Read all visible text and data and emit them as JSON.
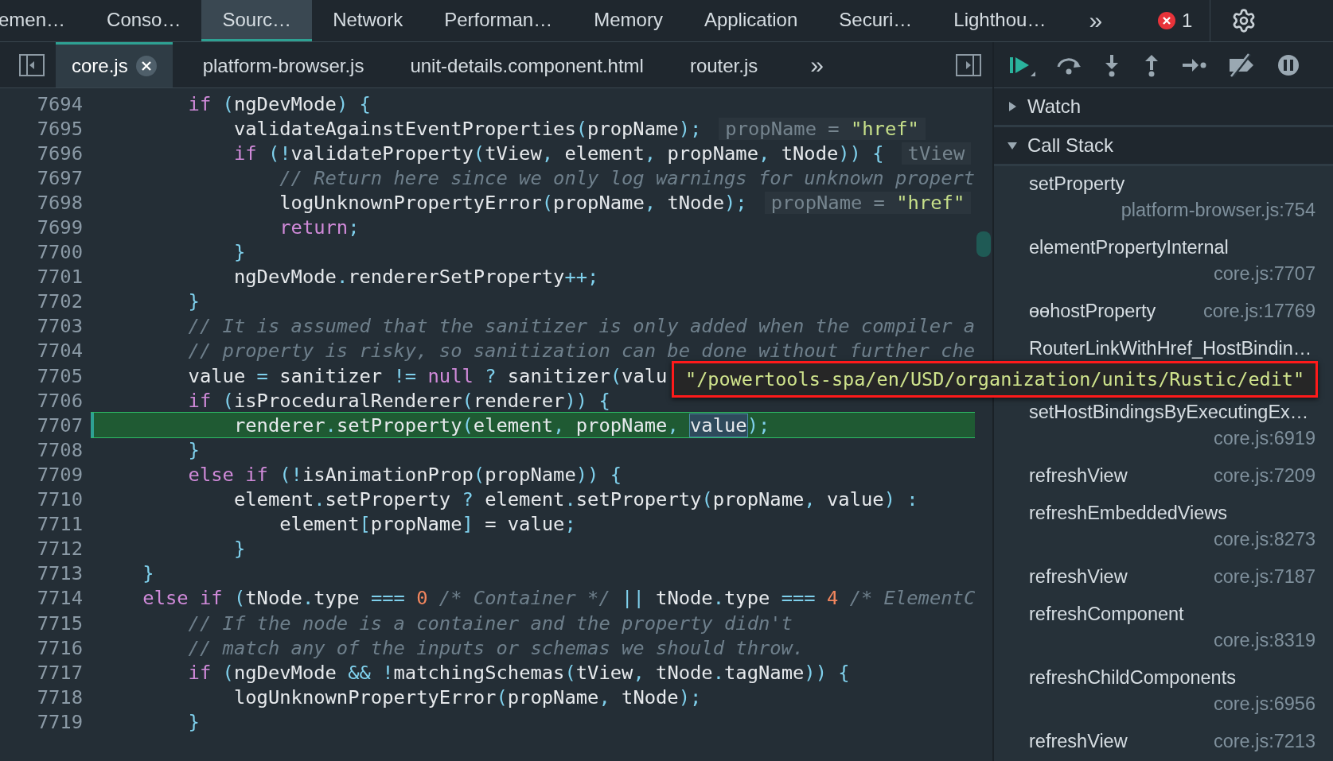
{
  "panel_tabs": [
    {
      "label": "emen…",
      "selected": false
    },
    {
      "label": "Conso…",
      "selected": false
    },
    {
      "label": "Sourc…",
      "selected": true
    },
    {
      "label": "Network",
      "selected": false
    },
    {
      "label": "Performan…",
      "selected": false
    },
    {
      "label": "Memory",
      "selected": false
    },
    {
      "label": "Application",
      "selected": false
    },
    {
      "label": "Securi…",
      "selected": false
    },
    {
      "label": "Lighthou…",
      "selected": false
    }
  ],
  "more_tabs": "»",
  "error_count": "1",
  "file_tabs": [
    {
      "label": "core.js",
      "selected": true,
      "closable": true
    },
    {
      "label": "platform-browser.js",
      "selected": false,
      "closable": false
    },
    {
      "label": "unit-details.component.html",
      "selected": false,
      "closable": false
    },
    {
      "label": "router.js",
      "selected": false,
      "closable": false
    }
  ],
  "more_files": "»",
  "code_lines": [
    {
      "number": "7694",
      "current": false,
      "tokens": [
        {
          "kind": "kw",
          "text": "        if "
        },
        {
          "kind": "p",
          "text": "("
        },
        {
          "kind": "id",
          "text": "ngDevMode"
        },
        {
          "kind": "p",
          "text": ") {"
        }
      ]
    },
    {
      "number": "7695",
      "current": false,
      "tokens": [
        {
          "kind": "id",
          "text": "            validateAgainstEventProperties"
        },
        {
          "kind": "p",
          "text": "("
        },
        {
          "kind": "id",
          "text": "propName"
        },
        {
          "kind": "p",
          "text": ");"
        }
      ],
      "inline_value": {
        "label": "propName =",
        "value": "\"href\""
      }
    },
    {
      "number": "7696",
      "current": false,
      "tokens": [
        {
          "kind": "kw",
          "text": "            if "
        },
        {
          "kind": "p",
          "text": "(!"
        },
        {
          "kind": "id",
          "text": "validateProperty"
        },
        {
          "kind": "p",
          "text": "("
        },
        {
          "kind": "id",
          "text": "tView"
        },
        {
          "kind": "p",
          "text": ", "
        },
        {
          "kind": "id",
          "text": "element"
        },
        {
          "kind": "p",
          "text": ", "
        },
        {
          "kind": "id",
          "text": "propName"
        },
        {
          "kind": "p",
          "text": ", "
        },
        {
          "kind": "id",
          "text": "tNode"
        },
        {
          "kind": "p",
          "text": ")) {"
        }
      ],
      "inline_value": {
        "label": "tView"
      }
    },
    {
      "number": "7697",
      "current": false,
      "tokens": [
        {
          "kind": "cm",
          "text": "                // Return here since we only log warnings for unknown propert"
        }
      ]
    },
    {
      "number": "7698",
      "current": false,
      "tokens": [
        {
          "kind": "id",
          "text": "                logUnknownPropertyError"
        },
        {
          "kind": "p",
          "text": "("
        },
        {
          "kind": "id",
          "text": "propName"
        },
        {
          "kind": "p",
          "text": ", "
        },
        {
          "kind": "id",
          "text": "tNode"
        },
        {
          "kind": "p",
          "text": ");"
        }
      ],
      "inline_value": {
        "label": "propName =",
        "value": "\"href\""
      }
    },
    {
      "number": "7699",
      "current": false,
      "tokens": [
        {
          "kind": "kw",
          "text": "                return"
        },
        {
          "kind": "p",
          "text": ";"
        }
      ]
    },
    {
      "number": "7700",
      "current": false,
      "tokens": [
        {
          "kind": "p",
          "text": "            }"
        }
      ]
    },
    {
      "number": "7701",
      "current": false,
      "tokens": [
        {
          "kind": "id",
          "text": "            ngDevMode"
        },
        {
          "kind": "p",
          "text": "."
        },
        {
          "kind": "id",
          "text": "rendererSetProperty"
        },
        {
          "kind": "p",
          "text": "++;"
        }
      ]
    },
    {
      "number": "7702",
      "current": false,
      "tokens": [
        {
          "kind": "p",
          "text": "        }"
        }
      ]
    },
    {
      "number": "7703",
      "current": false,
      "tokens": [
        {
          "kind": "cm",
          "text": "        // It is assumed that the sanitizer is only added when the compiler a"
        }
      ]
    },
    {
      "number": "7704",
      "current": false,
      "tokens": [
        {
          "kind": "cm",
          "text": "        // property is risky, so sanitization can be done without further che"
        }
      ]
    },
    {
      "number": "7705",
      "current": false,
      "tokens": [
        {
          "kind": "id",
          "text": "        value "
        },
        {
          "kind": "p",
          "text": "= "
        },
        {
          "kind": "id",
          "text": "sanitizer "
        },
        {
          "kind": "p",
          "text": "!= "
        },
        {
          "kind": "kw",
          "text": "null "
        },
        {
          "kind": "p",
          "text": "? "
        },
        {
          "kind": "id",
          "text": "sanitizer"
        },
        {
          "kind": "p",
          "text": "("
        },
        {
          "kind": "id",
          "text": "valu"
        }
      ]
    },
    {
      "number": "7706",
      "current": false,
      "tokens": [
        {
          "kind": "kw",
          "text": "        if "
        },
        {
          "kind": "p",
          "text": "("
        },
        {
          "kind": "id",
          "text": "isProceduralRenderer"
        },
        {
          "kind": "p",
          "text": "("
        },
        {
          "kind": "id",
          "text": "renderer"
        },
        {
          "kind": "p",
          "text": ")) {"
        }
      ]
    },
    {
      "number": "7707",
      "current": true,
      "tokens": [
        {
          "kind": "id",
          "text": "            renderer"
        },
        {
          "kind": "p",
          "text": "."
        },
        {
          "kind": "id",
          "text": "setProperty"
        },
        {
          "kind": "p",
          "text": "("
        },
        {
          "kind": "id",
          "text": "element"
        },
        {
          "kind": "p",
          "text": ", "
        },
        {
          "kind": "id",
          "text": "propName"
        },
        {
          "kind": "p",
          "text": ", "
        },
        {
          "kind": "hov",
          "text": "value"
        },
        {
          "kind": "p",
          "text": ");"
        }
      ]
    },
    {
      "number": "7708",
      "current": false,
      "tokens": [
        {
          "kind": "p",
          "text": "        }"
        }
      ]
    },
    {
      "number": "7709",
      "current": false,
      "tokens": [
        {
          "kind": "kw",
          "text": "        else if "
        },
        {
          "kind": "p",
          "text": "(!"
        },
        {
          "kind": "id",
          "text": "isAnimationProp"
        },
        {
          "kind": "p",
          "text": "("
        },
        {
          "kind": "id",
          "text": "propName"
        },
        {
          "kind": "p",
          "text": ")) {"
        }
      ]
    },
    {
      "number": "7710",
      "current": false,
      "tokens": [
        {
          "kind": "id",
          "text": "            element"
        },
        {
          "kind": "p",
          "text": "."
        },
        {
          "kind": "id",
          "text": "setProperty "
        },
        {
          "kind": "p",
          "text": "? "
        },
        {
          "kind": "id",
          "text": "element"
        },
        {
          "kind": "p",
          "text": "."
        },
        {
          "kind": "id",
          "text": "setProperty"
        },
        {
          "kind": "p",
          "text": "("
        },
        {
          "kind": "id",
          "text": "propName"
        },
        {
          "kind": "p",
          "text": ", "
        },
        {
          "kind": "id",
          "text": "value"
        },
        {
          "kind": "p",
          "text": ") :"
        }
      ]
    },
    {
      "number": "7711",
      "current": false,
      "tokens": [
        {
          "kind": "id",
          "text": "                element"
        },
        {
          "kind": "p",
          "text": "["
        },
        {
          "kind": "id",
          "text": "propName"
        },
        {
          "kind": "p",
          "text": "] "
        },
        {
          "kind": "id",
          "text": "= value"
        },
        {
          "kind": "p",
          "text": ";"
        }
      ]
    },
    {
      "number": "7712",
      "current": false,
      "tokens": [
        {
          "kind": "p",
          "text": "            }"
        }
      ]
    },
    {
      "number": "7713",
      "current": false,
      "tokens": [
        {
          "kind": "p",
          "text": "    }"
        }
      ]
    },
    {
      "number": "7714",
      "current": false,
      "tokens": [
        {
          "kind": "kw",
          "text": "    else if "
        },
        {
          "kind": "p",
          "text": "("
        },
        {
          "kind": "id",
          "text": "tNode"
        },
        {
          "kind": "p",
          "text": "."
        },
        {
          "kind": "id",
          "text": "type "
        },
        {
          "kind": "p",
          "text": "=== "
        },
        {
          "kind": "num",
          "text": "0 "
        },
        {
          "kind": "cm",
          "text": "/* Container */ "
        },
        {
          "kind": "p",
          "text": "|| "
        },
        {
          "kind": "id",
          "text": "tNode"
        },
        {
          "kind": "p",
          "text": "."
        },
        {
          "kind": "id",
          "text": "type "
        },
        {
          "kind": "p",
          "text": "=== "
        },
        {
          "kind": "num",
          "text": "4 "
        },
        {
          "kind": "cm",
          "text": "/* ElementC"
        }
      ]
    },
    {
      "number": "7715",
      "current": false,
      "tokens": [
        {
          "kind": "cm",
          "text": "        // If the node is a container and the property didn't"
        }
      ]
    },
    {
      "number": "7716",
      "current": false,
      "tokens": [
        {
          "kind": "cm",
          "text": "        // match any of the inputs or schemas we should throw."
        }
      ]
    },
    {
      "number": "7717",
      "current": false,
      "tokens": [
        {
          "kind": "kw",
          "text": "        if "
        },
        {
          "kind": "p",
          "text": "("
        },
        {
          "kind": "id",
          "text": "ngDevMode "
        },
        {
          "kind": "p",
          "text": "&& !"
        },
        {
          "kind": "id",
          "text": "matchingSchemas"
        },
        {
          "kind": "p",
          "text": "("
        },
        {
          "kind": "id",
          "text": "tView"
        },
        {
          "kind": "p",
          "text": ", "
        },
        {
          "kind": "id",
          "text": "tNode"
        },
        {
          "kind": "p",
          "text": "."
        },
        {
          "kind": "id",
          "text": "tagName"
        },
        {
          "kind": "p",
          "text": ")) {"
        }
      ]
    },
    {
      "number": "7718",
      "current": false,
      "tokens": [
        {
          "kind": "id",
          "text": "            logUnknownPropertyError"
        },
        {
          "kind": "p",
          "text": "("
        },
        {
          "kind": "id",
          "text": "propName"
        },
        {
          "kind": "p",
          "text": ", "
        },
        {
          "kind": "id",
          "text": "tNode"
        },
        {
          "kind": "p",
          "text": ");"
        }
      ]
    },
    {
      "number": "7719",
      "current": false,
      "tokens": [
        {
          "kind": "p",
          "text": "        }"
        }
      ]
    }
  ],
  "hover_tooltip": "\"/powertools-spa/en/USD/organization/units/Rustic/edit\"",
  "sections": [
    {
      "title": "Watch",
      "expanded": false
    },
    {
      "title": "Call Stack",
      "expanded": true
    }
  ],
  "call_stack": [
    {
      "name": "setProperty",
      "location": "platform-browser.js:754",
      "kind": "wrapped"
    },
    {
      "name": "elementPropertyInternal",
      "location": "core.js:7707",
      "kind": "wrapped"
    },
    {
      "name": "ɵɵhostProperty",
      "location": "core.js:17769",
      "kind": "inline"
    },
    {
      "name": "RouterLinkWithHref_HostBindin…",
      "kind": "wrapped"
    },
    {
      "name": "setHostBindingsByExecutingEx…",
      "location": "core.js:6919",
      "kind": "wrapped"
    },
    {
      "name": "refreshView",
      "location": "core.js:7209",
      "kind": "inline"
    },
    {
      "name": "refreshEmbeddedViews",
      "location": "core.js:8273",
      "kind": "wrapped"
    },
    {
      "name": "refreshView",
      "location": "core.js:7187",
      "kind": "inline"
    },
    {
      "name": "refreshComponent",
      "location": "core.js:8319",
      "kind": "wrapped"
    },
    {
      "name": "refreshChildComponents",
      "location": "core.js:6956",
      "kind": "wrapped"
    },
    {
      "name": "refreshView",
      "location": "core.js:7213",
      "kind": "inline"
    }
  ]
}
